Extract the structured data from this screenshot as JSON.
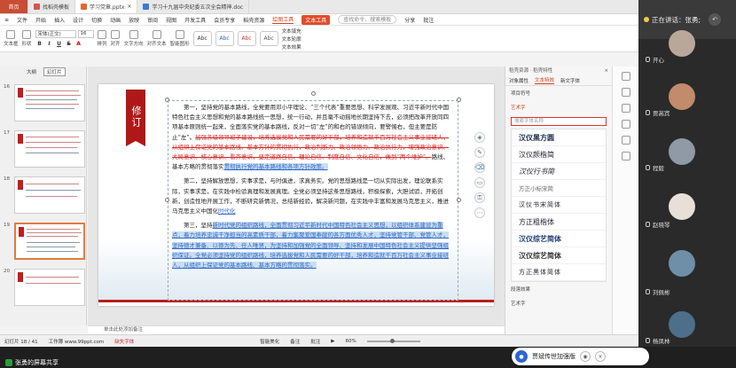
{
  "tabs": [
    {
      "label": "首页",
      "type": "home"
    },
    {
      "label": "找稻壳模板",
      "type": "normal"
    },
    {
      "label": "学习党章.pptx",
      "type": "active"
    },
    {
      "label": "学习十九届中央纪委五次全会精神.doc",
      "type": "normal"
    }
  ],
  "menu": {
    "items": [
      "文件",
      "开始",
      "插入",
      "设计",
      "切换",
      "动画",
      "放映",
      "审阅",
      "视图",
      "开发工具",
      "会员专享",
      "稻壳资源"
    ],
    "special": [
      "绘图工具",
      "文本工具"
    ],
    "search_placeholder": "查找命令、搜索模板",
    "right": [
      "分享",
      "批注"
    ]
  },
  "toolbar": {
    "font_name": "宋体(正文)",
    "font_size": "16",
    "buttons": [
      "文本框",
      "形状",
      "排列",
      "对齐",
      "文字方向",
      "对齐文本",
      "智能图形"
    ],
    "style_samples": [
      "Abc",
      "Abc",
      "Abc",
      "Abc"
    ],
    "text_options": [
      "文本填充",
      "文本轮廓",
      "文本效果"
    ]
  },
  "left_panel": {
    "tabs": [
      "大纲",
      "幻灯片"
    ],
    "slide_numbers": [
      "16",
      "17",
      "18",
      "19",
      "20"
    ]
  },
  "slide": {
    "banner": "修订",
    "para1_plain": "第一，坚持党的基本路线，全党要用邓小平理论、“三个代表”重要思想、科学发展观、习近平新时代中国特色社会主义思想和党的基本路线统一思想，统一行动，并且毫不动摇地长期坚持下去，必须把改革开放同四项基本原则统一起来，全面落实党的基本路线，反对一切“左”的和右的错误倾向，要警惕右，但主要是防止“左”。",
    "para1_strike": "加强各级领导班子建设，培养选拔党和人民需要的好干部，培养和造就千百万社会主义事业接班人，从组织上保证党的基本路线、基本方针的贯彻执行，政治判断力、政治领悟力、政治执行力，增强政治意识、大局意识、核心意识、看齐意识，坚定道路自信、理论自信、制度自信、文化自信，做到“两个维护”。",
    "para1_tail": "路线、基本方略的贯彻落实",
    "para1_blue": "贯彻执行党的基本路线和各项方针政策。",
    "para2_plain": "第二，坚持解放思想，实事求是，与时俱进，求真务实。党的思想路线是一切从实际出发，理论联系实际，实事求是，在实践中检验真理和发展真理。全党必须坚持这条思想路线，积极探索，大胆试验，开拓创新，创造性地开展工作，不断研究新情况，总结新经验，解决新问题，在实践中丰富和发展马克思主义，推进马克思主义中国化",
    "para2_blue": "时代化",
    "para3_plain": "第三，坚持",
    "para3_blue": "新时代党的组织路线，全面贯彻习近平新时代中国特色社会主义思想，以组织体系建设为重点，着力培养忠诚干净担当的高素质干部，着力集聚爱国奉献的各方面优秀人才，坚持党管干部、党管人才，坚持德才兼备、以德为先、任人唯贤，为坚持和加强党的全面领导、坚持和发展中国特色社会主义提供坚强组织保证。全党必须坚持党的组织路线，培养选拔党和人民需要的好干部，培养和造就千百万社会主义事业接班人，从组织上保证党的基本路线、基本方略的贯彻落实。"
  },
  "float_tools": [
    "layers-icon",
    "pen-icon",
    "eraser-icon",
    "shapes-icon",
    "lock-icon",
    "more-icon"
  ],
  "notes_placeholder": "单击此处添加备注",
  "right_panel": {
    "header": "稻壳资源 · 稻壳特性",
    "tabs": [
      "对象属性",
      "文本特效",
      "新文字体"
    ],
    "section1": "项目符号",
    "section2": "艺术字",
    "search_placeholder": "搜索字体名称",
    "fonts": [
      "汉仪黑方圆",
      "汉仪颜楷简",
      "汉仪行书简",
      "方正小标宋简",
      "汉仪书宋简体",
      "方正粗楷体",
      "汉仪综艺简体",
      "汉仪综艺简体",
      "方正黑体简体"
    ],
    "section3": "段落效果",
    "section4": "艺术字"
  },
  "statusbar": {
    "slide_info": "幻灯片 18 / 41",
    "theme": "工作簿 www.99ppt.com",
    "font_missing": "缺失字体",
    "smart_beautify": "智能美化",
    "notes": "备注",
    "comments": "批注",
    "zoom": "60%"
  },
  "share": {
    "label": "张勇的屏幕共享"
  },
  "voice": {
    "label": "贾斌传世加强版"
  },
  "meeting": {
    "speaking_label": "正在讲话：张勇;",
    "participants": [
      "开心",
      "贾高宾",
      "程毅",
      "赵晓琴",
      "刘佩彬",
      "杨凤林"
    ]
  }
}
